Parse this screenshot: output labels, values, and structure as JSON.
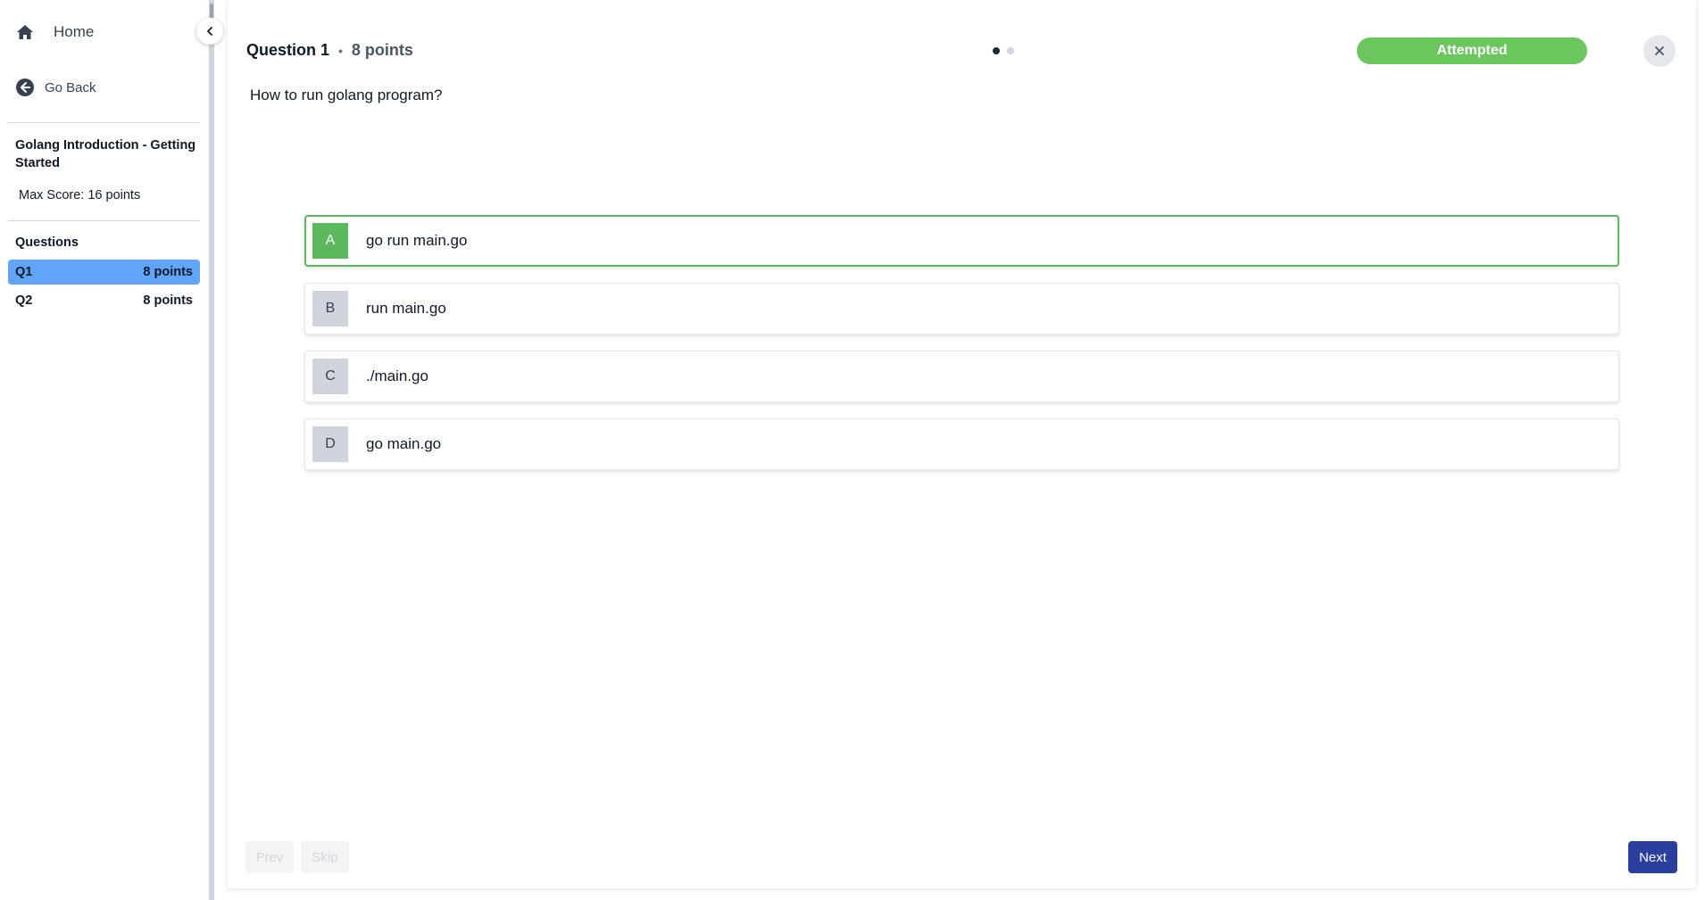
{
  "sidebar": {
    "home_label": "Home",
    "back_label": "Go Back",
    "course_title": "Golang Introduction - Getting Started",
    "max_score_label": "Max Score:",
    "max_score_value": "16 points",
    "questions_heading": "Questions",
    "questions": [
      {
        "id": "Q1",
        "points": "8 points",
        "active": true
      },
      {
        "id": "Q2",
        "points": "8 points",
        "active": false
      }
    ]
  },
  "question": {
    "title": "Question 1",
    "points": "8 points",
    "status": "Attempted",
    "text": "How to run golang program?",
    "pager_total": 2,
    "pager_current": 1,
    "options": [
      {
        "letter": "A",
        "text": "go run main.go",
        "selected": true
      },
      {
        "letter": "B",
        "text": "run main.go",
        "selected": false
      },
      {
        "letter": "C",
        "text": "./main.go",
        "selected": false
      },
      {
        "letter": "D",
        "text": "go main.go",
        "selected": false
      }
    ]
  },
  "footer": {
    "prev_label": "Prev",
    "skip_label": "Skip",
    "next_label": "Next"
  },
  "colors": {
    "accent_green": "#5cb85c",
    "status_green": "#6bc65e",
    "active_question": "#60a5fa",
    "next_button": "#2b3f9e"
  },
  "icons": {
    "home": "home-icon",
    "back": "arrow-left-circle-icon",
    "collapse": "chevron-left-icon",
    "close": "close-icon"
  }
}
